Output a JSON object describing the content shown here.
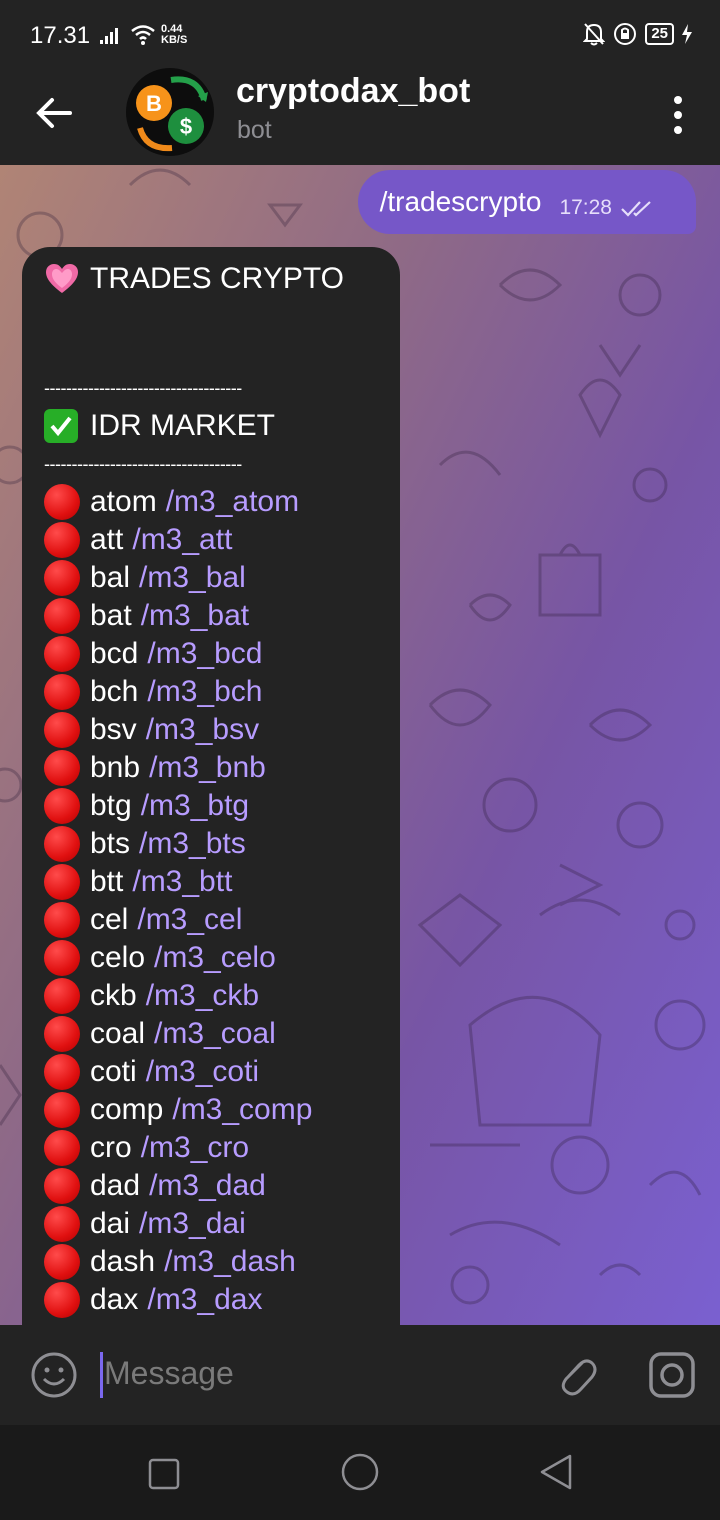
{
  "status": {
    "time": "17.31",
    "speed_value": "0.44",
    "speed_unit": "KB/S",
    "battery": "25"
  },
  "header": {
    "title": "cryptodax_bot",
    "subtitle": "bot"
  },
  "outgoing": {
    "text": "/tradescrypto",
    "time": "17:28"
  },
  "incoming": {
    "heading": "TRADES CRYPTO",
    "divider": "------------------------------------",
    "section": "IDR MARKET",
    "items": [
      {
        "name": "atom",
        "cmd": "/m3_atom"
      },
      {
        "name": "att",
        "cmd": "/m3_att"
      },
      {
        "name": "bal",
        "cmd": "/m3_bal"
      },
      {
        "name": "bat",
        "cmd": "/m3_bat"
      },
      {
        "name": "bcd",
        "cmd": "/m3_bcd"
      },
      {
        "name": "bch",
        "cmd": "/m3_bch"
      },
      {
        "name": "bsv",
        "cmd": "/m3_bsv"
      },
      {
        "name": "bnb",
        "cmd": "/m3_bnb"
      },
      {
        "name": "btg",
        "cmd": "/m3_btg"
      },
      {
        "name": "bts",
        "cmd": "/m3_bts"
      },
      {
        "name": "btt",
        "cmd": "/m3_btt"
      },
      {
        "name": "cel",
        "cmd": "/m3_cel"
      },
      {
        "name": "celo",
        "cmd": "/m3_celo"
      },
      {
        "name": "ckb",
        "cmd": "/m3_ckb"
      },
      {
        "name": "coal",
        "cmd": "/m3_coal"
      },
      {
        "name": "coti",
        "cmd": "/m3_coti"
      },
      {
        "name": "comp",
        "cmd": "/m3_comp"
      },
      {
        "name": "cro",
        "cmd": "/m3_cro"
      },
      {
        "name": "dad",
        "cmd": "/m3_dad"
      },
      {
        "name": "dai",
        "cmd": "/m3_dai"
      },
      {
        "name": "dash",
        "cmd": "/m3_dash"
      },
      {
        "name": "dax",
        "cmd": "/m3_dax"
      }
    ]
  },
  "composer": {
    "placeholder": "Message"
  },
  "colors": {
    "bar": "#232323",
    "accent": "#7657c8",
    "command_link": "#b79cff"
  },
  "icons": [
    "back-arrow-icon",
    "more-vert-icon",
    "heart-emoji-icon",
    "check-mark-icon",
    "red-circle-icon",
    "smiley-icon",
    "paperclip-icon",
    "camera-icon"
  ]
}
